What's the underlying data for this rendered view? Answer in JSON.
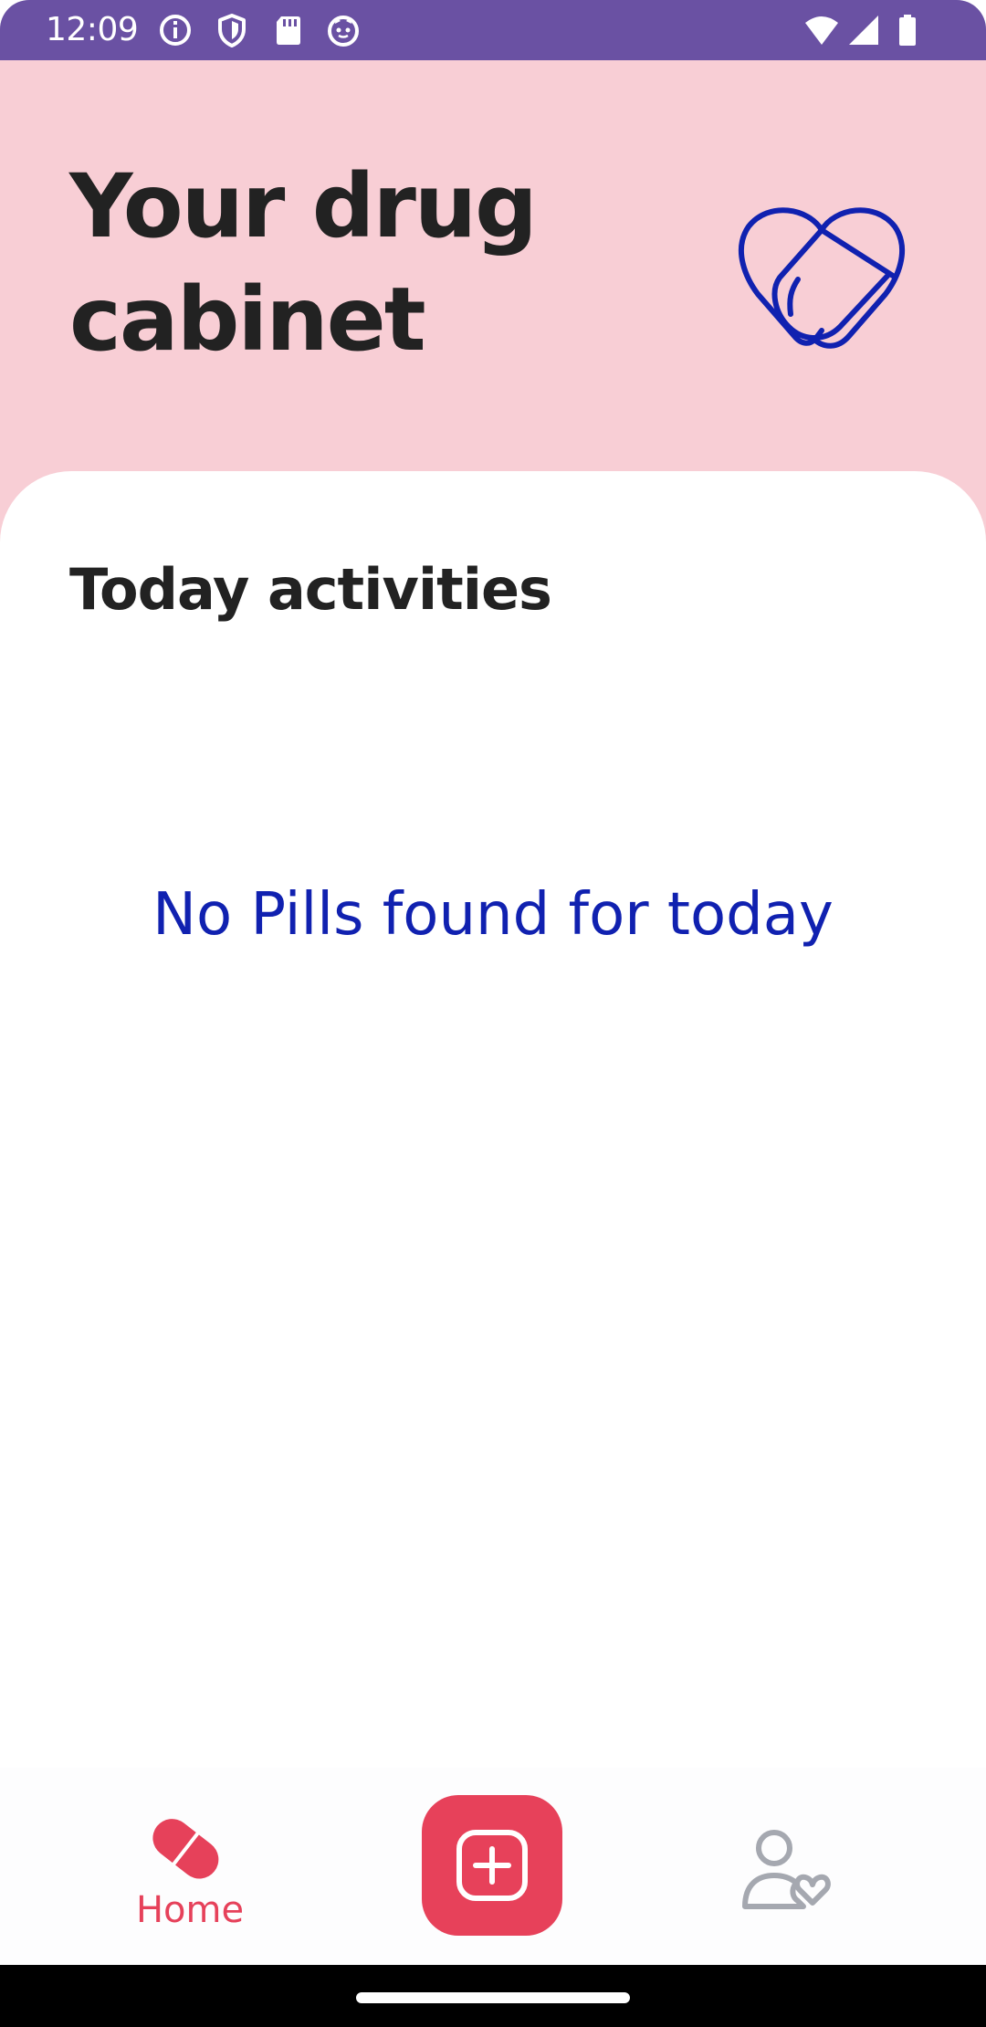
{
  "status_bar": {
    "time": "12:09",
    "background_color": "#6a51a3",
    "left_icons": [
      "info-icon",
      "shield-icon",
      "sd-card-icon",
      "cat-face-icon"
    ],
    "right_icons": [
      "wifi-icon",
      "signal-icon",
      "battery-icon"
    ]
  },
  "header": {
    "title": "Your drug cabinet",
    "background_color": "#f8ced5",
    "logo_icon": "heart-pill-icon",
    "logo_color": "#1021b0"
  },
  "main": {
    "section_title": "Today activities",
    "empty_message": "No Pills found for today",
    "empty_message_color": "#1021b0"
  },
  "bottom_nav": {
    "home_label": "Home",
    "home_icon": "pill-icon",
    "add_icon": "add-square-icon",
    "profile_icon": "user-heart-icon",
    "active_color": "#e6415a",
    "inactive_color": "#a5a8b0"
  }
}
